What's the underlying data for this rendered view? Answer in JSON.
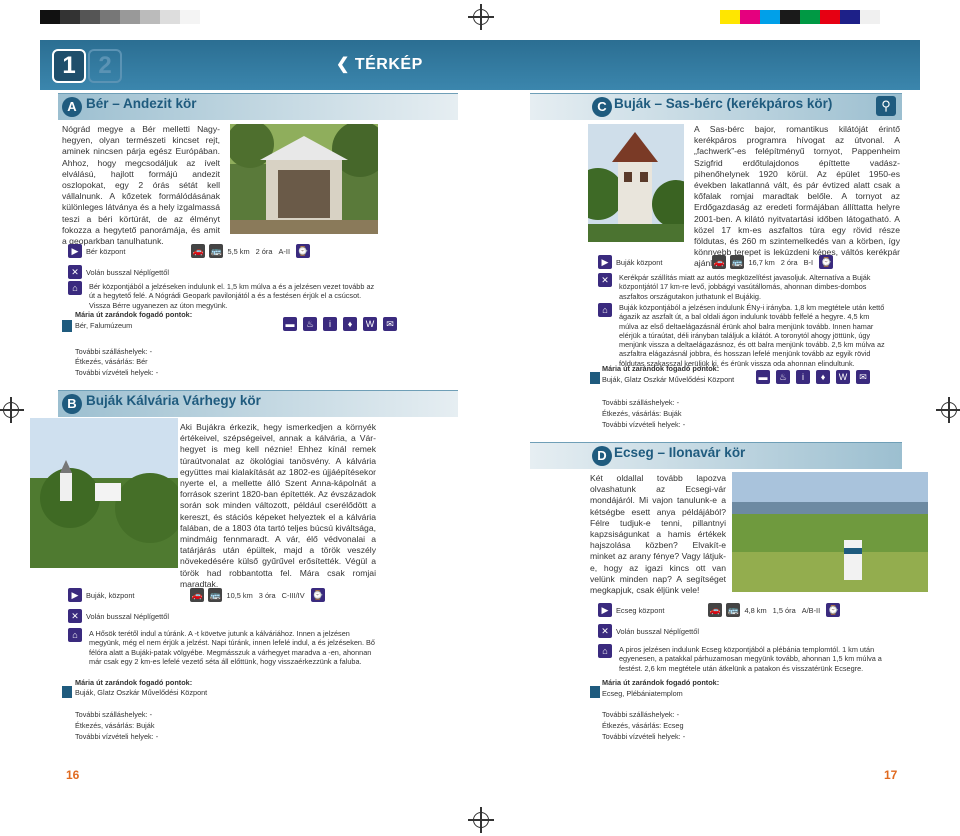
{
  "header": {
    "tab1": "1",
    "tab2": "2",
    "title": "❮ TÉRKÉP"
  },
  "sections": {
    "A": {
      "letter": "A",
      "title": "Bér – Andezit kör",
      "body": "Nógrád megye a Bér melletti Nagy-hegyen, olyan természeti kincset rejt, aminek nincsen párja egész Európában. Ahhoz, hogy megcsodáljuk az ívelt elválású, hajlott formájú andezit oszlopokat, egy 2 órás sétát kell vállalnunk. A kőzetek formálódásának különleges látványa és a hely izgalmassá teszi a béri körtúrát, de az élményt fokozza a hegytető panorámája, és amit a geoparkban tanulhatunk.",
      "start": "Bér központ",
      "distance": "5,5 km",
      "time": "2 óra",
      "difficulty": "A-II",
      "transport": "Volán busszal Néplígettől",
      "route": "Bér központjából a jelzéseken indulunk el. 1,5 km múlva a és a jelzésen vezet tovább az út a hegytető felé. A Nógrádi Geopark pavilonjától a és a festésen érjük el a csúcsot. Vissza Bérre ugyanezen az úton megyünk.",
      "stamp_title": "Mária út zarándok fogadó pontok:",
      "stamp_place": "Bér, Falumúzeum",
      "lodging": "További szálláshelyek: -",
      "food": "Étkezés, vásárlás: Bér",
      "water": "További vízvételi helyek: -"
    },
    "B": {
      "letter": "B",
      "title": "Buják Kálvária Várhegy kör",
      "body": "Aki Bujákra érkezik, hegy ismerkedjen a környék értékeivel, szépségeivel, annak a kálvária, a Vár-hegyet is meg kell néznie! Ehhez kínál remek túraútvonalat az ökológiai tanösvény. A kálvária együttes mai kialakítását az 1802-es újjáépítésekor nyerte el, a mellette álló Szent Anna-kápolnát a források szerint 1820-ban építették. Az évszázadok során sok minden változott, például cserélődött a kereszt, és stációs képeket helyeztek el a kálvária falában, de a 1803 óta tartó teljes búcsú kiváltsága, mindmáig fennmaradt. A vár, élő védvonalai a tatárjárás után épültek, majd a török veszély növekedésére külső gyűrűvel erősítették. Végül a török had robbantotta fel. Mára csak romjai maradtak.",
      "start": "Buják, központ",
      "distance": "10,5 km",
      "time": "3 óra",
      "difficulty": "C-III/IV",
      "transport": "Volán busszal Néplígettől",
      "route": "A Hősök terétől indul a túránk. A -t követve jutunk a kálváriához. Innen a jelzésen megyünk, még el nem érjük a jelzést. Napi túránk, innen lefelé indul, a és jelzéseken. Bő félóra alatt a Bujáki-patak völgyébe. Megmásszuk a várhegyet maradva a -en, ahonnan már csak egy 2 km-es lefelé vezető séta áll előttünk, hogy visszaérkezzünk a faluba.",
      "stamp_title": "Mária út zarándok fogadó pontok:",
      "stamp_place": "Buják, Glatz Oszkár Művelődési Központ",
      "lodging": "További szálláshelyek: -",
      "food": "Étkezés, vásárlás: Buják",
      "water": "További vízvételi helyek: -"
    },
    "C": {
      "letter": "C",
      "title": "Buják – Sas-bérc (kerékpáros kör)",
      "body": "A Sas-bérc bajor, romantikus kilátóját érintő kerékpáros programra hívogat az útvonal. A „fachwerk”-es felépítményű tornyot, Pappenheim Szigfrid erdőtulajdonos építtette vadász-pihenőhelynek 1920 körül. Az épület 1950-es években lakatlanná vált, és pár évtized alatt csak a kőfalak romjai maradtak belőle. A tornyot az Erdőgazdaság az eredeti formájában állíttatta helyre 2001-ben. A kilátó nyitvatartási időben látogatható. A közel 17 km-es aszfaltos túra egy rövid része földutas, és 260 m szintemelkedés van a körben, így könnyebb terepet is lekúzdeni képes, váltós kerékpár ajánlott.",
      "start": "Buják központ",
      "distance": "16,7 km",
      "time": "2 óra",
      "difficulty": "B-I",
      "transport": "Kerékpár szállítás miatt az autós megközelítést javasoljuk. Alternatíva a Buják központjától 17 km-re levő, jobbágyi vasútállomás, ahonnan dimbes-dombos aszfaltos országutakon juthatunk el Bujákig.",
      "route": "Buják központjából a jelzésen indulunk ÉNy-i irányba. 1,8 km megtétele után kettő ágazik az aszfalt út, a bal oldali ágon indulunk tovább felfelé a hegyre. 4,5 km múlva az első deltaelágazásnál érünk ahol balra menjünk tovább. Innen hamar elérjük a túraútat, déli irányban találjuk a kilátót. A toronytól ahogy jöttünk, úgy menjünk vissza a deltaelágazásnoz, és ott balra menjünk tovább. 2,5 km múlva az aszfaltra elágazásnál jobbra, és hosszan lefelé menjünk tovább az egyik rövid földutas szakasszal kerüljük ki, és érünk vissza oda ahonnan elindultunk.",
      "stamp_title": "Mária út zarándok fogadó pontok:",
      "stamp_place": "Buják, Glatz Oszkár Művelődési Központ",
      "lodging": "További szálláshelyek: -",
      "food": "Étkezés, vásárlás: Buják",
      "water": "További vízvételi helyek: -"
    },
    "D": {
      "letter": "D",
      "title": "Ecseg – Ilonavár kör",
      "body": "Két oldallal tovább lapozva olvashatunk az Ecsegi-vár mondájáról. Mi vajon tanulunk-e a kétségbe esett anya példájából? Félre tudjuk-e tenni, pillantnyi kapzsiságunkat a hamis értékek hajszolása közben? Elvakít-e minket az arany fénye? Vagy látjuk-e, hogy az igazi kincs ott van velünk minden nap? A segítséget megkapjuk, csak éljünk vele!",
      "start": "Ecseg központ",
      "distance": "4,8 km",
      "time": "1,5 óra",
      "difficulty": "A/B-II",
      "transport": "Volán busszal Néplígettől",
      "route": "A piros jelzésen indulunk Ecseg központjából a plébánia templomtól. 1 km után egyenesen, a patakkal párhuzamosan megyünk tovább, ahonnan 1,5 km múlva a festést. 2,6 km megtétele után átkelünk a patakon és visszatérünk Ecsegre.",
      "stamp_title": "Mária út zarándok fogadó pontok:",
      "stamp_place": "Ecseg, Plébániatemplom",
      "lodging": "További szálláshelyek: -",
      "food": "Étkezés, vásárlás: Ecseg",
      "water": "További vízvételi helyek: -"
    }
  },
  "pages": {
    "left": "16",
    "right": "17"
  },
  "colors": {
    "accent": "#1f5b7e",
    "header": "#2b6e92",
    "icon": "#3a2a7e",
    "pagenum": "#e06a1f"
  }
}
